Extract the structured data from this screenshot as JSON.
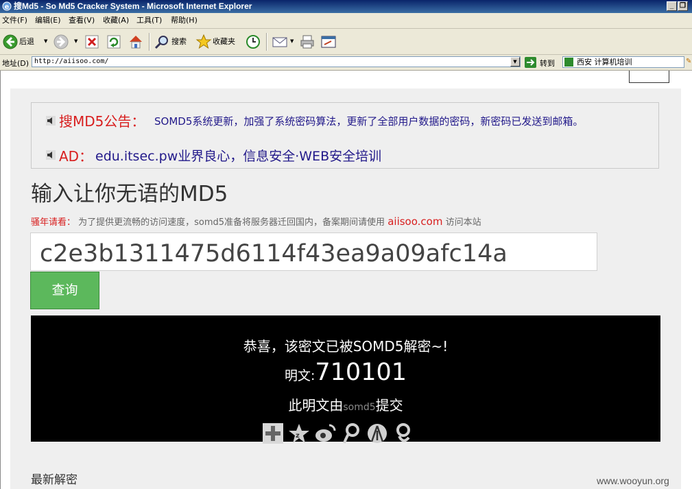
{
  "window": {
    "title": "搜Md5 - So Md5 Cracker System - Microsoft Internet Explorer",
    "minimize": "_",
    "restore": "❐"
  },
  "menu": [
    {
      "label": "文件(F)"
    },
    {
      "label": "编辑(E)"
    },
    {
      "label": "查看(V)"
    },
    {
      "label": "收藏(A)"
    },
    {
      "label": "工具(T)"
    },
    {
      "label": "帮助(H)"
    }
  ],
  "toolbar": {
    "back_label": "后退",
    "search_label": "搜索",
    "favorites_label": "收藏夹"
  },
  "address": {
    "label": "地址(D)",
    "url": "http://aiisoo.com/",
    "go_label": "转到",
    "search_value": "西安 计算机培训"
  },
  "notice": {
    "label1": "搜MD5公告：",
    "text1": "SOMD5系统更新，加强了系统密码算法，更新了全部用户数据的密码，新密码已发送到邮箱。",
    "label2": "AD：",
    "text2": "edu.itsec.pw业界良心，信息安全·WEB安全培训"
  },
  "headline": "输入让你无语的MD5",
  "tip": {
    "label": "骚年请看：",
    "text": " 为了提供更流畅的访问速度，somd5准备将服务器迁回国内，备案期间请使用 ",
    "link": "aiisoo.com",
    "suffix": " 访问本站"
  },
  "query": {
    "hash": "c2e3b1311475d6114f43ea9a09afc14a",
    "button": "查询"
  },
  "result": {
    "congrats": "恭喜，该密文已被SOMD5解密~!",
    "plain_label": "明文:",
    "plain_value": "710101",
    "submit_prefix": "此明文由",
    "submit_user": "somd5",
    "submit_suffix": "提交"
  },
  "share_icons": [
    "plus-share-icon",
    "qzone-star-icon",
    "weibo-icon",
    "tencent-weibo-icon",
    "renren-icon",
    "kaixin-icon"
  ],
  "recent_label": "最新解密",
  "watermark": "www.wooyun.org",
  "colors": {
    "ie_title_start": "#0a246a",
    "chrome": "#ece9d8",
    "notice_red": "#d81e1e",
    "notice_blue": "#22198a",
    "button_green": "#5cb85c",
    "result_bg": "#000000"
  }
}
